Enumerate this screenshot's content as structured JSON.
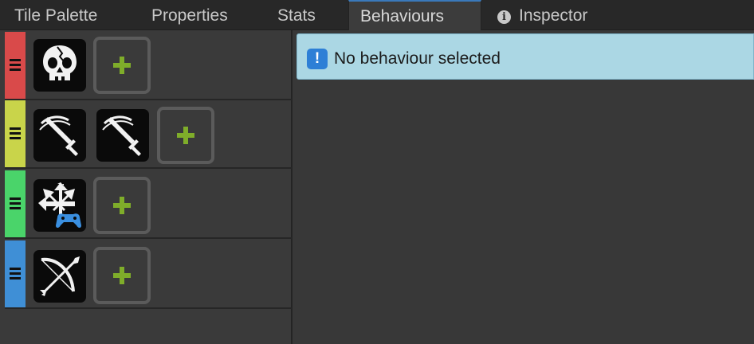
{
  "tabs": [
    {
      "label": "Tile Palette",
      "active": false
    },
    {
      "label": "Properties",
      "active": false
    },
    {
      "label": "Stats",
      "active": false
    },
    {
      "label": "Behaviours",
      "active": true
    },
    {
      "label": "Inspector",
      "active": false,
      "icon": "info-icon"
    }
  ],
  "rows": [
    {
      "color": "#d94a4a",
      "tiles": [
        "skull-icon"
      ]
    },
    {
      "color": "#c9d44a",
      "tiles": [
        "sword-slash-icon",
        "sword-slash-icon"
      ]
    },
    {
      "color": "#4ad46a",
      "tiles": [
        "move-gamepad-icon"
      ]
    },
    {
      "color": "#3f8fd6",
      "tiles": [
        "bow-arrow-icon"
      ]
    }
  ],
  "add_button_icon": "plus-icon",
  "notice": {
    "icon": "exclamation-icon",
    "message": "No behaviour selected"
  },
  "colors": {
    "accent": "#3a79bb",
    "plus": "#7fad2a",
    "notice_bg": "#abd7e4"
  }
}
